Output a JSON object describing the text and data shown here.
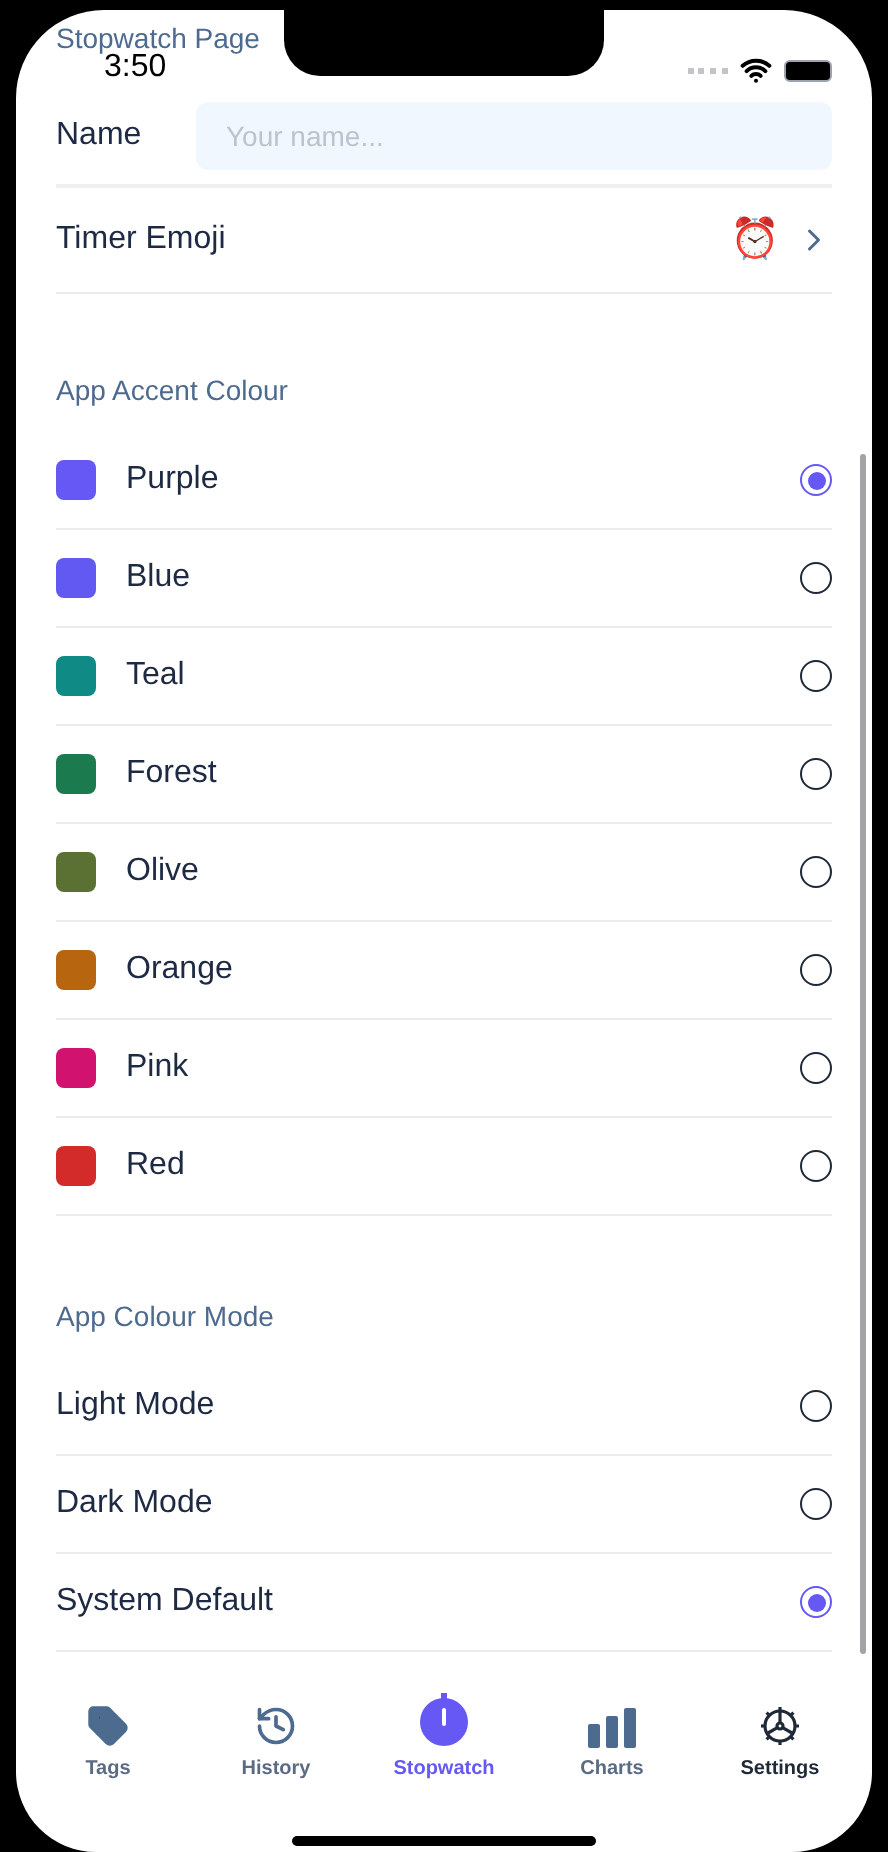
{
  "status_bar": {
    "time": "3:50"
  },
  "header": {
    "title": "Stopwatch Page"
  },
  "name_field": {
    "label": "Name",
    "placeholder": "Your name..."
  },
  "timer_emoji": {
    "label": "Timer Emoji",
    "value": "⏰"
  },
  "accent_section": {
    "title": "App Accent Colour",
    "options": [
      {
        "label": "Purple",
        "color": "#6558f5",
        "selected": true
      },
      {
        "label": "Blue",
        "color": "#6259f2",
        "selected": false
      },
      {
        "label": "Teal",
        "color": "#0f8a84",
        "selected": false
      },
      {
        "label": "Forest",
        "color": "#1b7a4e",
        "selected": false
      },
      {
        "label": "Olive",
        "color": "#5a7133",
        "selected": false
      },
      {
        "label": "Orange",
        "color": "#b7650f",
        "selected": false
      },
      {
        "label": "Pink",
        "color": "#d2126f",
        "selected": false
      },
      {
        "label": "Red",
        "color": "#d32a2a",
        "selected": false
      }
    ]
  },
  "mode_section": {
    "title": "App Colour Mode",
    "options": [
      {
        "label": "Light Mode",
        "selected": false
      },
      {
        "label": "Dark Mode",
        "selected": false
      },
      {
        "label": "System Default",
        "selected": true
      }
    ]
  },
  "tab_bar": [
    {
      "kind": "tags",
      "label": "Tags",
      "selected": false
    },
    {
      "kind": "history",
      "label": "History",
      "selected": false
    },
    {
      "kind": "stopwatch",
      "label": "Stopwatch",
      "selected": true
    },
    {
      "kind": "charts",
      "label": "Charts",
      "selected": false
    },
    {
      "kind": "settings",
      "label": "Settings",
      "selected": false
    }
  ]
}
